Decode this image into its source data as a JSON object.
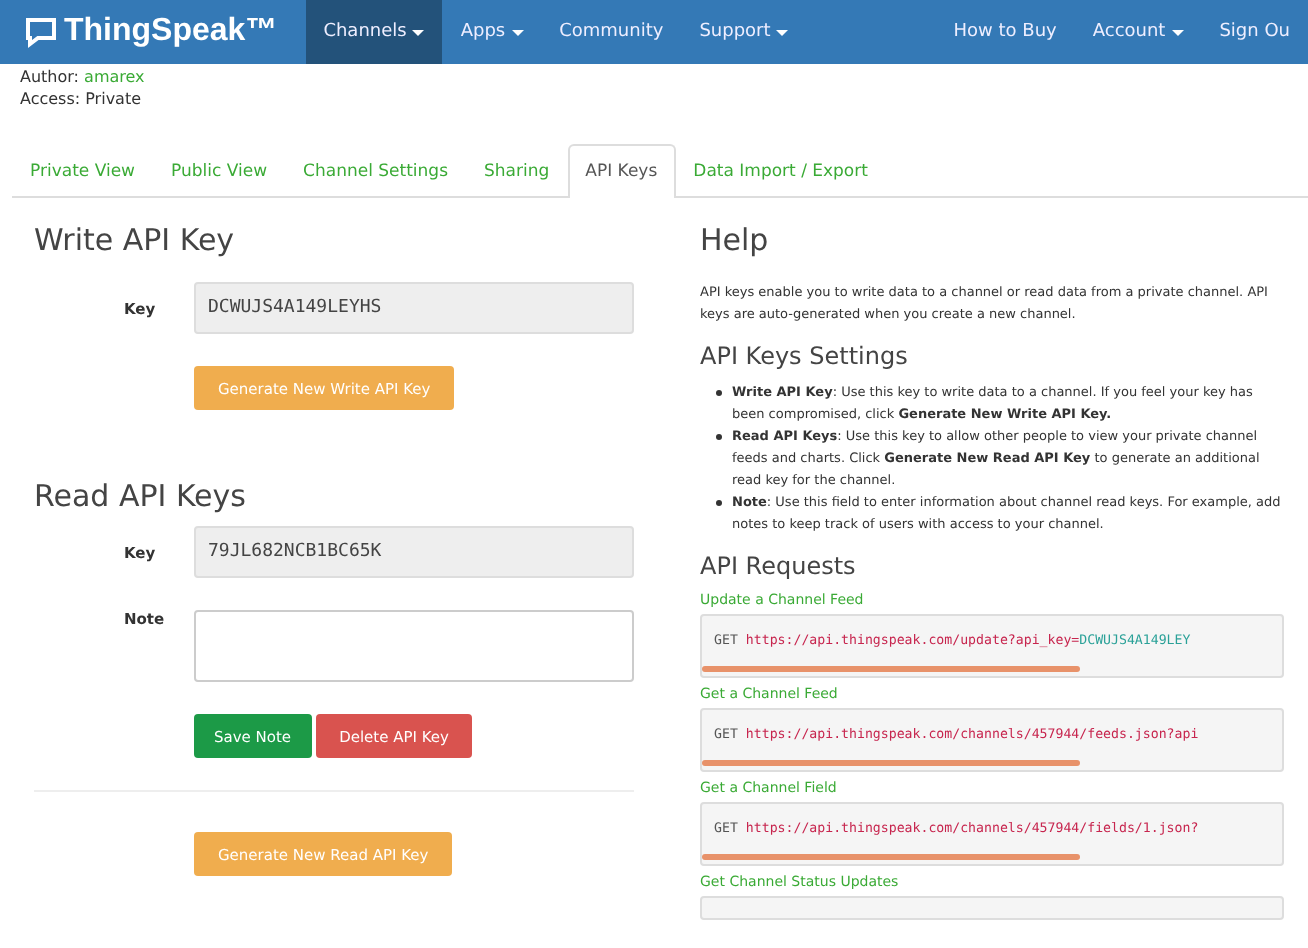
{
  "navbar": {
    "brand": "ThingSpeak™",
    "items": [
      {
        "label": "Channels",
        "dropdown": true,
        "selected": true
      },
      {
        "label": "Apps",
        "dropdown": true,
        "selected": false
      },
      {
        "label": "Community",
        "dropdown": false,
        "selected": false
      },
      {
        "label": "Support",
        "dropdown": true,
        "selected": false
      }
    ],
    "right_items": [
      {
        "label": "How to Buy",
        "dropdown": false
      },
      {
        "label": "Account",
        "dropdown": true
      },
      {
        "label": "Sign Ou",
        "dropdown": false
      }
    ]
  },
  "channel_info": {
    "author_label": "Author:",
    "author": "amarex",
    "access": "Access: Private"
  },
  "tabs": [
    {
      "label": "Private View",
      "selected": false
    },
    {
      "label": "Public View",
      "selected": false
    },
    {
      "label": "Channel Settings",
      "selected": false
    },
    {
      "label": "Sharing",
      "selected": false
    },
    {
      "label": "API Keys",
      "selected": true
    },
    {
      "label": "Data Import / Export",
      "selected": false
    }
  ],
  "write_key": {
    "title": "Write API Key",
    "key_label": "Key",
    "key": "DCWUJS4A149LEYHS",
    "button": "Generate New Write API Key"
  },
  "read_keys": {
    "title": "Read API Keys",
    "key_label": "Key",
    "key": "79JL682NCB1BC65K",
    "note_label": "Note",
    "save_button": "Save Note",
    "delete_button": "Delete API Key",
    "generate_button": "Generate New Read API Key"
  },
  "help": {
    "title": "Help",
    "text": "API keys enable you to write data to a channel or read data from a private channel. API keys are auto-generated when you create a new channel.",
    "settings_title": "API Keys Settings",
    "settings": [
      "**Write API Key**: Use this key to write data to a channel. If you feel your key has been compromised, click **Generate New Write API Key.**",
      "**Read API Keys**: Use this key to allow other people to view your private channel feeds and charts. Click **Generate New Read API Key** to generate an additional read key for the channel.",
      "**Note**: Use this field to enter information about channel read keys. For example, add notes to keep track of users with access to your channel."
    ],
    "requests_title": "API Requests",
    "requests": [
      {
        "title": "Update a Channel Feed",
        "method": "GET",
        "url": "https://api.thingspeak.com/update?api_key=",
        "query": "DCWUJS4A149LEY"
      },
      {
        "title": "Get a Channel Feed",
        "method": "GET",
        "url": "https://api.thingspeak.com/channels/457944/feeds.json?api"
      },
      {
        "title": "Get a Channel Field",
        "method": "GET",
        "url": "https://api.thingspeak.com/channels/457944/fields/1.json?"
      },
      {
        "title": "Get Channel Status Updates"
      }
    ]
  }
}
